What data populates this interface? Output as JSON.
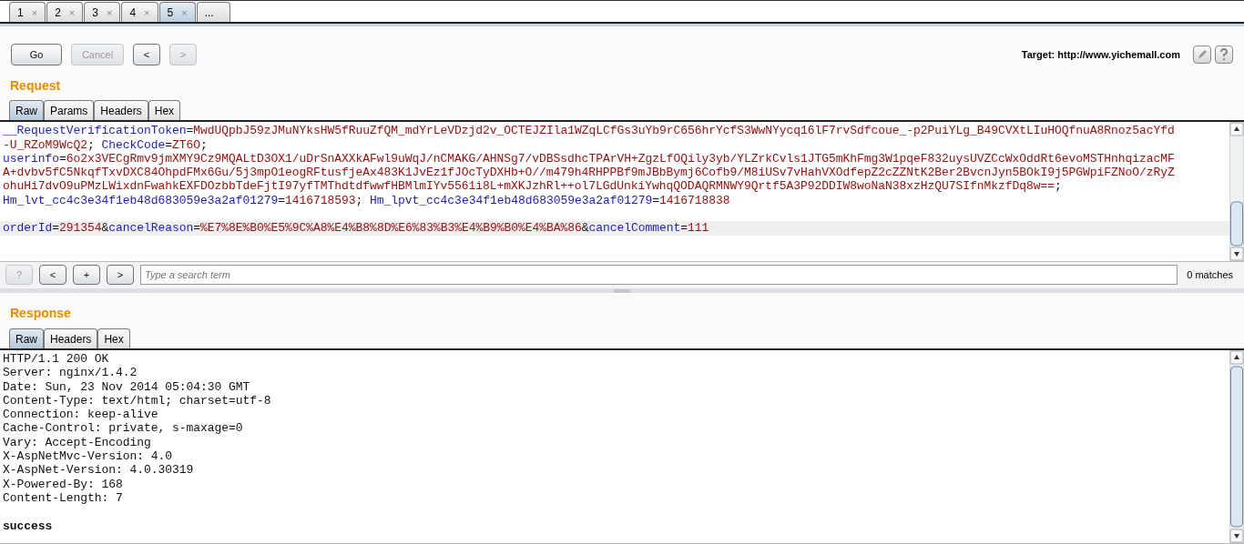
{
  "tabs": [
    {
      "label": "1",
      "close": "×",
      "selected": false
    },
    {
      "label": "2",
      "close": "×",
      "selected": false
    },
    {
      "label": "3",
      "close": "×",
      "selected": false
    },
    {
      "label": "4",
      "close": "×",
      "selected": false
    },
    {
      "label": "5",
      "close": "×",
      "selected": true
    },
    {
      "label": "...",
      "selected": false
    }
  ],
  "toolbar": {
    "buttons": [
      {
        "label": "Go",
        "disabled": false
      },
      {
        "label": "Cancel",
        "disabled": true
      },
      {
        "label": "<",
        "disabled": false
      },
      {
        "label": ">",
        "disabled": true
      }
    ],
    "target": "Target: http://www.yichemall.com"
  },
  "request": {
    "title": "Request",
    "tabs": [
      {
        "label": "Raw",
        "selected": true
      },
      {
        "label": "Params",
        "selected": false
      },
      {
        "label": "Headers",
        "selected": false
      },
      {
        "label": "Hex",
        "selected": false
      }
    ],
    "lines": [
      {
        "highlighted": false,
        "segments": [
          {
            "kind": "key",
            "text": "__RequestVerificationToken"
          },
          {
            "kind": "punct",
            "text": "="
          },
          {
            "kind": "value",
            "text": "MwdUQpbJ59zJMuNYksHW5fRuuZfQM_mdYrLeVDzjd2v_OCTEJZIla1WZqLCfGs3uYb9rC656hrYcfS3WwNYycq16lF7rvSdfcoue_-p2PuiYLg_B49CVXtLIuHOQfnuA8Rnoz5acYfd"
          }
        ]
      },
      {
        "highlighted": false,
        "segments": [
          {
            "kind": "value",
            "text": "-U_RZoM9WcQ2"
          },
          {
            "kind": "punct",
            "text": "; "
          },
          {
            "kind": "key",
            "text": "CheckCode"
          },
          {
            "kind": "punct",
            "text": "="
          },
          {
            "kind": "value",
            "text": "ZT6O"
          },
          {
            "kind": "punct",
            "text": ";"
          }
        ]
      },
      {
        "highlighted": false,
        "segments": [
          {
            "kind": "key",
            "text": "userinfo"
          },
          {
            "kind": "punct",
            "text": "="
          },
          {
            "kind": "value",
            "text": "6o2x3VECgRmv9jmXMY9Cz9MQALtD3OX1/uDrSnAXXkAFwl9uWqJ/nCMAKG/AHNSg7/vDBSsdhcTPArVH+ZgzLfOQily3yb/YLZrkCvls1JTG5mKhFmg3W1pqeF832uysUVZCcWxOddRt6evoMSTHnhqizacMF"
          }
        ]
      },
      {
        "highlighted": false,
        "segments": [
          {
            "kind": "value",
            "text": "A+dvbv5fC5NkqfTxvDXC84OhpdFMx6Gu/5j3mpO1eogRFtusfjeAx483K1JvEz1fJOcTyDXHb+O//m479h4RHPPBf9mJBbBymj6Cofb9/M8iUSv7vHahVXOdfepZ2cZZNtK2Ber2BvcnJyn5BOkI9j5PGWpiFZNoO/zRyZ"
          }
        ]
      },
      {
        "highlighted": false,
        "segments": [
          {
            "kind": "value",
            "text": "ohuHi7dvO9uPMzLWixdnFwahkEXFDOzbbTdeFjtI97yfTMThdtdfwwfHBMlmIYv5561i8L+mXKJzhRl++ol7LGdUnkiYwhqQODAQRMNWY9Qrtf5A3P92DDIW8woNaN38xzHzQU7SIfnMkzfDq8w=="
          },
          {
            "kind": "punct",
            "text": ";"
          }
        ]
      },
      {
        "highlighted": false,
        "segments": [
          {
            "kind": "key",
            "text": "Hm_lvt_cc4c3e34f1eb48d683059e3a2af01279"
          },
          {
            "kind": "punct",
            "text": "="
          },
          {
            "kind": "value",
            "text": "1416718593"
          },
          {
            "kind": "punct",
            "text": "; "
          },
          {
            "kind": "key",
            "text": "Hm_lpvt_cc4c3e34f1eb48d683059e3a2af01279"
          },
          {
            "kind": "punct",
            "text": "="
          },
          {
            "kind": "value",
            "text": "1416718838"
          }
        ]
      },
      {
        "kind": "blank"
      },
      {
        "highlighted": true,
        "segments": [
          {
            "kind": "key",
            "text": "orderId"
          },
          {
            "kind": "punct",
            "text": "="
          },
          {
            "kind": "value",
            "text": "291354"
          },
          {
            "kind": "punct",
            "text": "&"
          },
          {
            "kind": "key",
            "text": "cancelReason"
          },
          {
            "kind": "punct",
            "text": "="
          },
          {
            "kind": "value",
            "text": "%E7%8E%B0%E5%9C%A8%E4%B8%8D%E6%83%B3%E4%B9%B0%E4%BA%86"
          },
          {
            "kind": "punct",
            "text": "&"
          },
          {
            "kind": "key",
            "text": "cancelComment"
          },
          {
            "kind": "punct",
            "text": "="
          },
          {
            "kind": "value",
            "text": "111"
          }
        ]
      }
    ]
  },
  "search": {
    "buttons": [
      "?",
      "<",
      "+",
      ">"
    ],
    "placeholder": "Type a search term",
    "matches": "0 matches"
  },
  "response": {
    "title": "Response",
    "tabs": [
      {
        "label": "Raw",
        "selected": true
      },
      {
        "label": "Headers",
        "selected": false
      },
      {
        "label": "Hex",
        "selected": false
      }
    ],
    "lines": [
      {
        "kind": "header",
        "text": "HTTP/1.1 200 OK"
      },
      {
        "kind": "header",
        "text": "Server: nginx/1.4.2"
      },
      {
        "kind": "header",
        "text": "Date: Sun, 23 Nov 2014 05:04:30 GMT"
      },
      {
        "kind": "header",
        "text": "Content-Type: text/html; charset=utf-8"
      },
      {
        "kind": "header",
        "text": "Connection: keep-alive"
      },
      {
        "kind": "header",
        "text": "Cache-Control: private, s-maxage=0"
      },
      {
        "kind": "header",
        "text": "Vary: Accept-Encoding"
      },
      {
        "kind": "header",
        "text": "X-AspNetMvc-Version: 4.0"
      },
      {
        "kind": "header",
        "text": "X-AspNet-Version: 4.0.30319"
      },
      {
        "kind": "header",
        "text": "X-Powered-By: 168"
      },
      {
        "kind": "header",
        "text": "Content-Length: 7"
      },
      {
        "kind": "blank"
      },
      {
        "kind": "body",
        "text": "success"
      }
    ]
  }
}
